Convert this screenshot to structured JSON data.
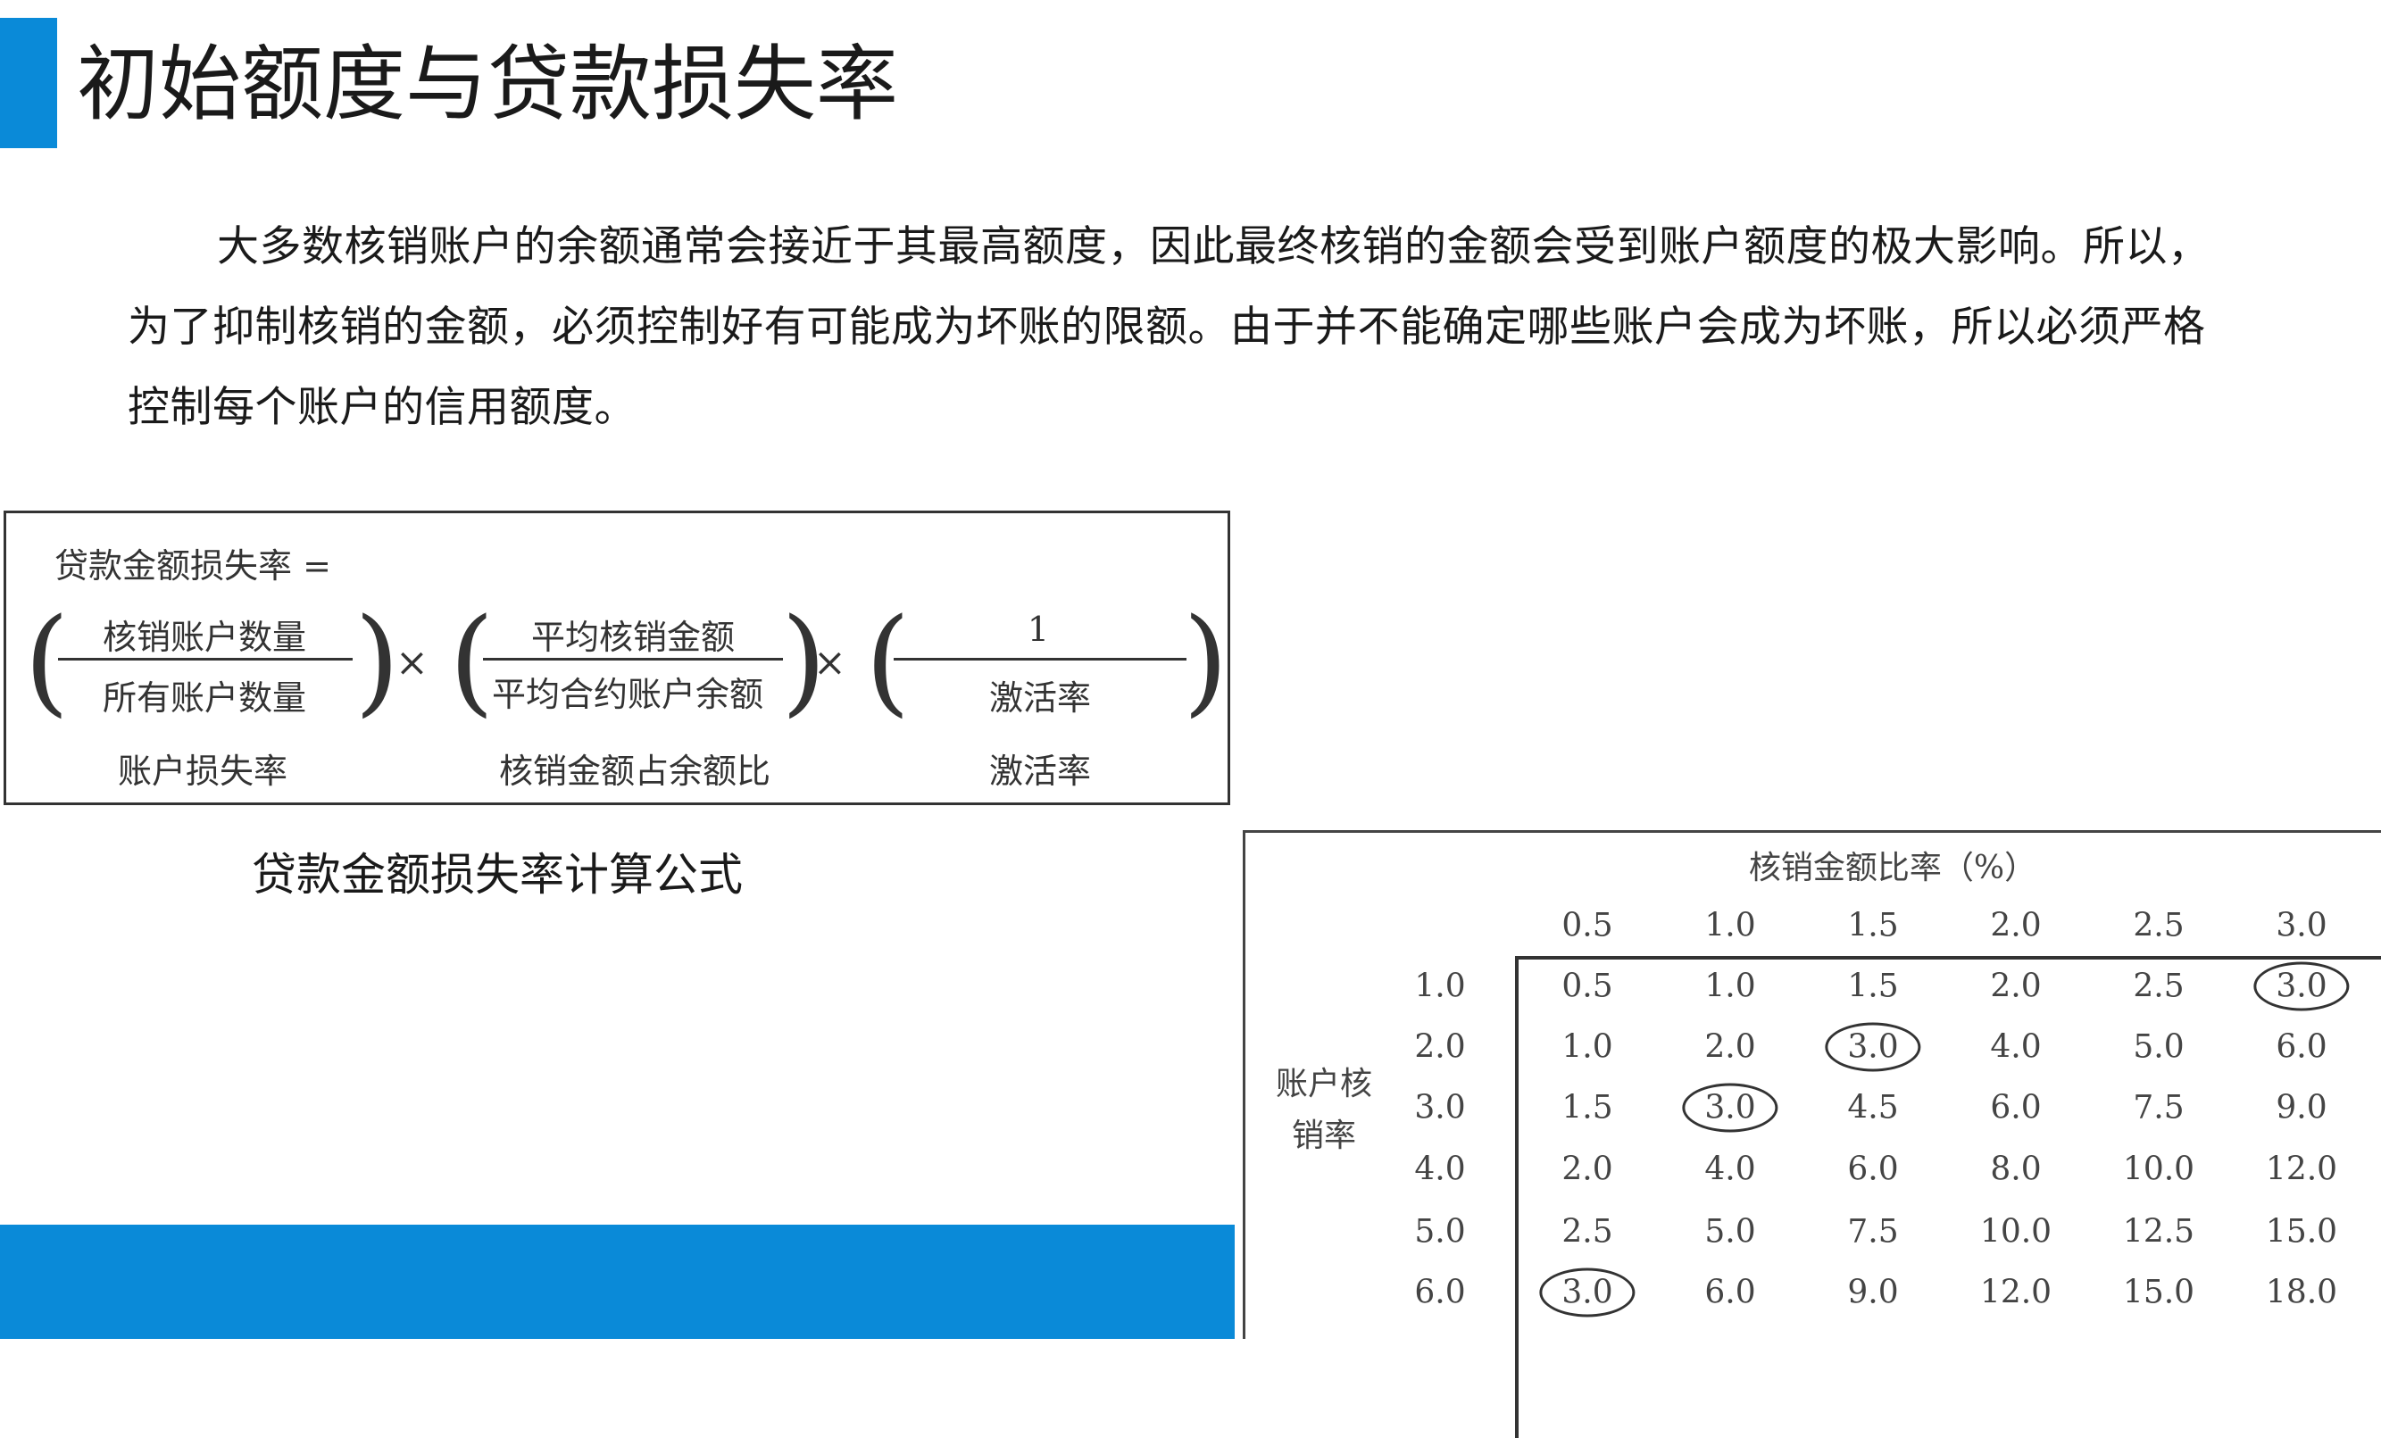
{
  "title": "初始额度与贷款损失率",
  "paragraph": "大多数核销账户的余额通常会接近于其最高额度，因此最终核销的金额会受到账户额度的极大影响。所以，为了抑制核销的金额，必须控制好有可能成为坏账的限额。由于并不能确定哪些账户会成为坏账，所以必须严格控制每个账户的信用额度。",
  "formula": {
    "lhs": "贷款金额损失率 =",
    "term1": {
      "numerator": "核销账户数量",
      "denominator": "所有账户数量",
      "label": "账户损失率"
    },
    "term2": {
      "numerator": "平均核销金额",
      "denominator": "平均合约账户余额",
      "label": "核销金额占余额比"
    },
    "term3": {
      "numerator": "1",
      "denominator": "激活率",
      "label": "激活率"
    },
    "operator": "×",
    "caption": "贷款金额损失率计算公式"
  },
  "matrix": {
    "column_title": "核销金额比率（%）",
    "row_title_line1": "账户核",
    "row_title_line2": "销率",
    "col_headers": [
      "0.5",
      "1.0",
      "1.5",
      "2.0",
      "2.5",
      "3.0"
    ],
    "row_headers": [
      "1.0",
      "2.0",
      "3.0",
      "4.0",
      "5.0",
      "6.0"
    ],
    "cells": [
      [
        "0.5",
        "1.0",
        "1.5",
        "2.0",
        "2.5",
        "3.0"
      ],
      [
        "1.0",
        "2.0",
        "3.0",
        "4.0",
        "5.0",
        "6.0"
      ],
      [
        "1.5",
        "3.0",
        "4.5",
        "6.0",
        "7.5",
        "9.0"
      ],
      [
        "2.0",
        "4.0",
        "6.0",
        "8.0",
        "10.0",
        "12.0"
      ],
      [
        "2.5",
        "5.0",
        "7.5",
        "10.0",
        "12.5",
        "15.0"
      ],
      [
        "3.0",
        "6.0",
        "9.0",
        "12.0",
        "15.0",
        "18.0"
      ]
    ],
    "circled_cells": [
      [
        0,
        5
      ],
      [
        1,
        2
      ],
      [
        2,
        1
      ],
      [
        5,
        0
      ]
    ]
  },
  "colors": {
    "accent": "#0a8ad8"
  }
}
